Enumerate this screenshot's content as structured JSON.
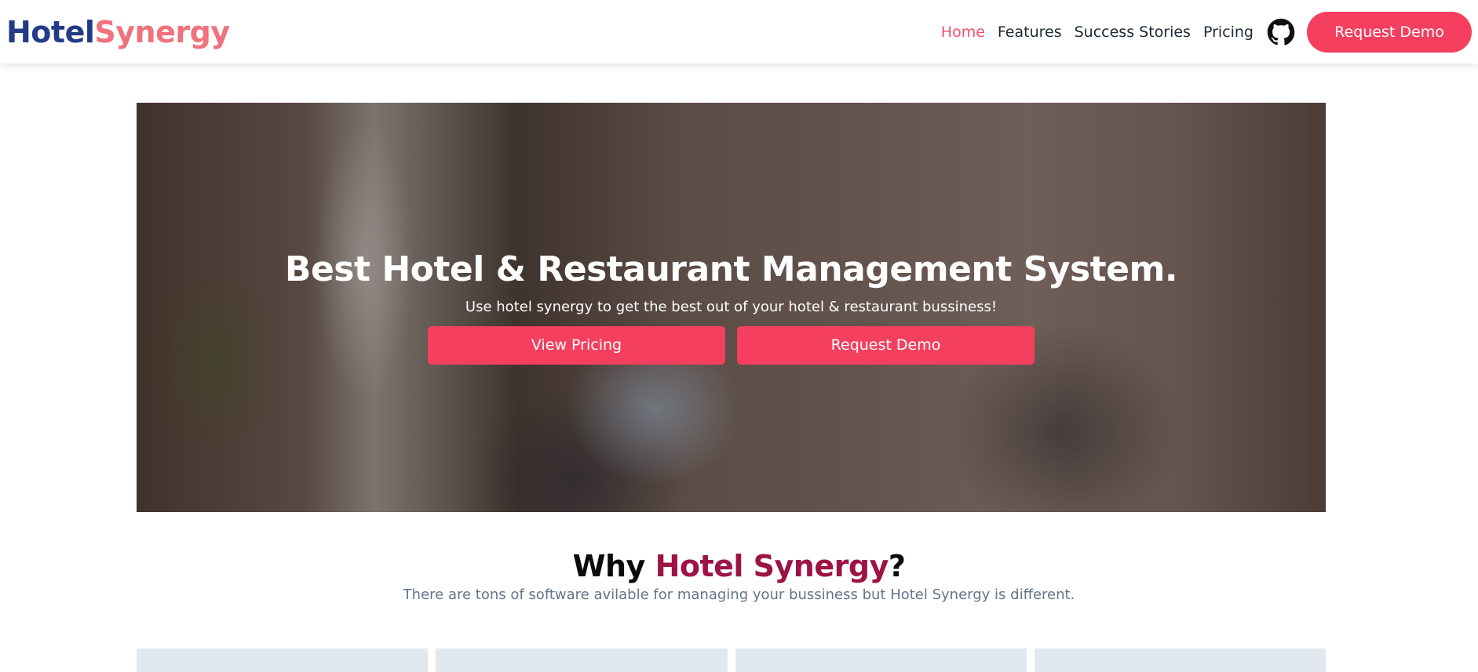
{
  "nav": {
    "logo_part_a": "Hotel",
    "logo_part_b": "Synergy",
    "links": [
      "Home",
      "Features",
      "Success Stories",
      "Pricing"
    ],
    "active_link": "Home",
    "github_icon": "github-icon",
    "cta_label": "Request Demo"
  },
  "hero": {
    "title": "Best Hotel & Restaurant Management System.",
    "subtitle": "Use hotel synergy to get the best out of your hotel & restaurant bussiness!",
    "buttons": [
      "View Pricing",
      "Request Demo"
    ]
  },
  "why": {
    "title_prefix": "Why ",
    "title_accent": "Hotel Synergy",
    "title_suffix": "?",
    "subtitle": "There are tons of software avilable for managing your bussiness but Hotel Synergy is different."
  },
  "colors": {
    "brand_blue": "#233b86",
    "brand_pink": "#f0727c",
    "accent": "#f43f5e",
    "accent_dark": "#9d1444"
  }
}
